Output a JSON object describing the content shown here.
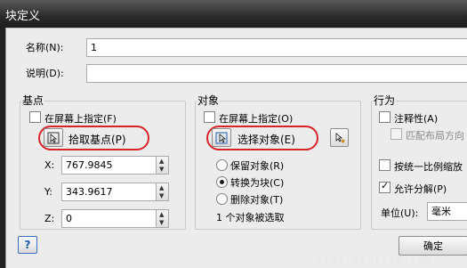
{
  "window": {
    "title": "块定义"
  },
  "name": {
    "label": "名称(N):",
    "value": "1"
  },
  "description": {
    "label": "说明(D):",
    "value": ""
  },
  "basepoint": {
    "title": "基点",
    "specify_onscreen": "在屏幕上指定(F)",
    "pick_button": "拾取基点(P)",
    "x_label": "X:",
    "x_value": "767.9845",
    "y_label": "Y:",
    "y_value": "343.9617",
    "z_label": "Z:",
    "z_value": "0"
  },
  "objects": {
    "title": "对象",
    "specify_onscreen": "在屏幕上指定(O)",
    "select_button": "选择对象(E)",
    "retain": "保留对象(R)",
    "convert": "转换为块(C)",
    "delete": "删除对象(T)",
    "status": "1 个对象被选取"
  },
  "behavior": {
    "title": "行为",
    "annotative": "注释性(A)",
    "match_orientation": "匹配布局方向",
    "scale_uniformly": "按统一比例缩放",
    "allow_exploding": "允许分解(P)",
    "units_label": "单位(U):",
    "units_value": "毫米"
  },
  "footer": {
    "help": "?",
    "ok": "确定"
  },
  "watermark": "tigerenglish.com"
}
